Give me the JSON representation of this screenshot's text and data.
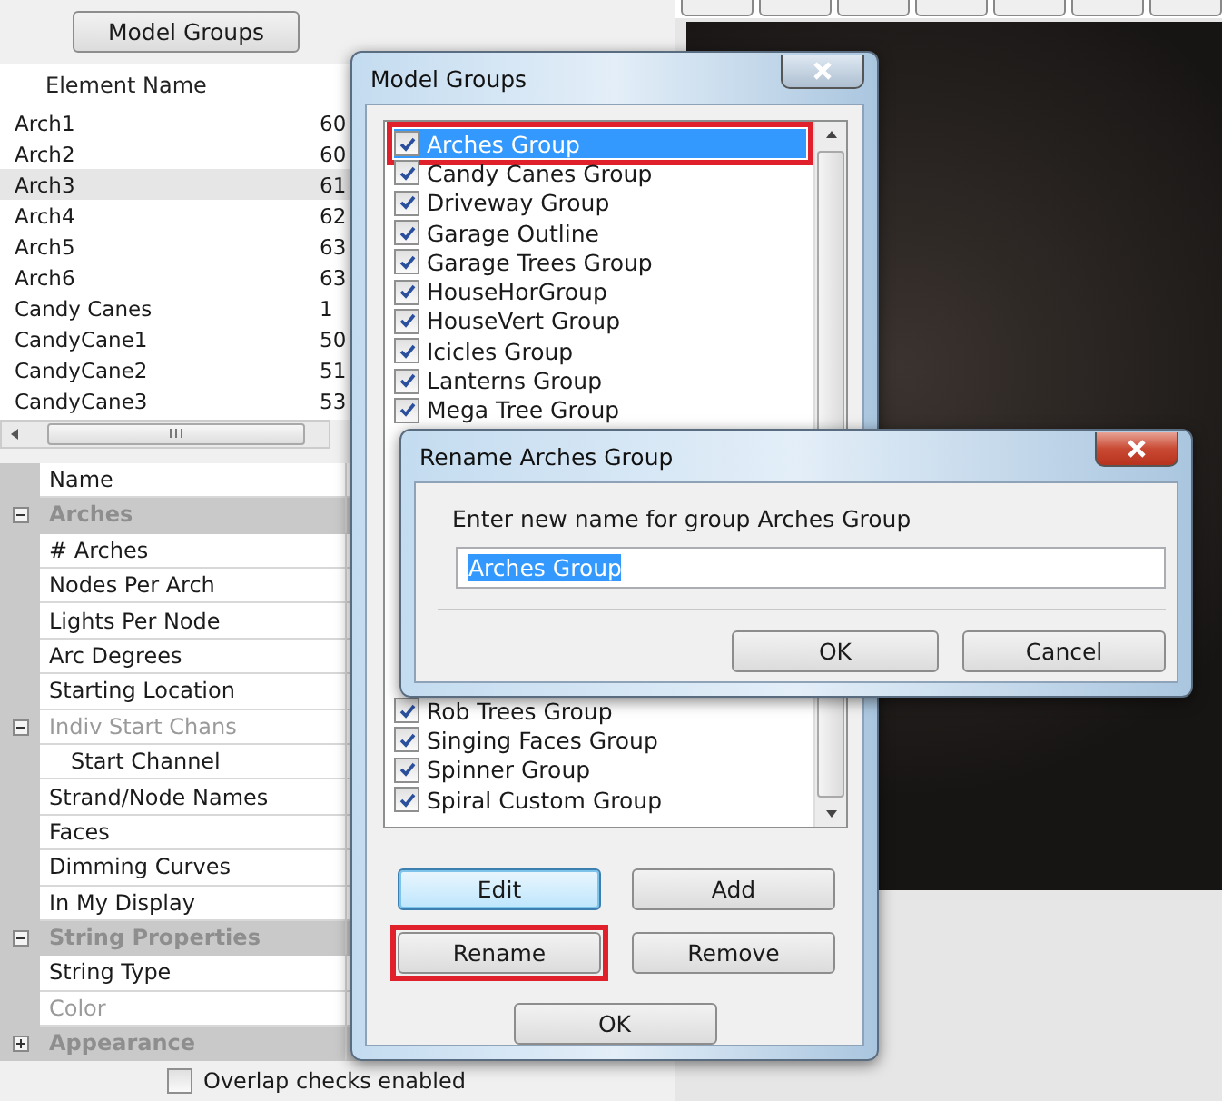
{
  "left_panel": {
    "model_groups_button": "Model Groups",
    "element_list": {
      "columns": [
        "Element Name"
      ],
      "rows": [
        {
          "name": "Arch1",
          "column_2": "60",
          "selected": false
        },
        {
          "name": "Arch2",
          "column_2": "60",
          "selected": false
        },
        {
          "name": "Arch3",
          "column_2": "61",
          "selected": true
        },
        {
          "name": "Arch4",
          "column_2": "62",
          "selected": false
        },
        {
          "name": "Arch5",
          "column_2": "63",
          "selected": false
        },
        {
          "name": "Arch6",
          "column_2": "63",
          "selected": false
        },
        {
          "name": "Candy Canes",
          "column_2": "1",
          "selected": false
        },
        {
          "name": "CandyCane1",
          "column_2": "50",
          "selected": false
        },
        {
          "name": "CandyCane2",
          "column_2": "51",
          "selected": false
        },
        {
          "name": "CandyCane3",
          "column_2": "53",
          "selected": false
        }
      ]
    },
    "properties": [
      {
        "kind": "property",
        "label": "Name",
        "disabled": false
      },
      {
        "kind": "category",
        "label": "Arches",
        "expanded": true,
        "children": [
          {
            "kind": "property",
            "label": "# Arches",
            "disabled": false
          },
          {
            "kind": "property",
            "label": "Nodes Per Arch",
            "disabled": false
          },
          {
            "kind": "property",
            "label": "Lights Per Node",
            "disabled": false
          },
          {
            "kind": "property",
            "label": "Arc Degrees",
            "disabled": false
          },
          {
            "kind": "property",
            "label": "Starting Location",
            "disabled": false
          },
          {
            "kind": "property",
            "label": "Indiv Start Chans",
            "disabled": true,
            "expanded": true,
            "children": [
              {
                "kind": "property",
                "label": "Start Channel",
                "disabled": false
              }
            ]
          },
          {
            "kind": "property",
            "label": "Strand/Node Names",
            "disabled": false
          },
          {
            "kind": "property",
            "label": "Faces",
            "disabled": false
          },
          {
            "kind": "property",
            "label": "Dimming Curves",
            "disabled": false
          },
          {
            "kind": "property",
            "label": "In My Display",
            "disabled": false
          }
        ]
      },
      {
        "kind": "category",
        "label": "String Properties",
        "expanded": true,
        "children": [
          {
            "kind": "property",
            "label": "String Type",
            "disabled": false
          },
          {
            "kind": "property",
            "label": "Color",
            "disabled": true
          }
        ]
      },
      {
        "kind": "category",
        "label": "Appearance",
        "expanded": false
      }
    ],
    "overlap_checkbox": {
      "label": "Overlap checks enabled",
      "checked": false
    }
  },
  "model_groups_dialog": {
    "title": "Model Groups",
    "list_top": [
      {
        "label": "Arches Group",
        "checked": true,
        "selected": true,
        "annotated": true
      },
      {
        "label": "Candy Canes Group",
        "checked": true,
        "selected": false,
        "annotated": false
      },
      {
        "label": "Driveway Group",
        "checked": true,
        "selected": false,
        "annotated": false
      },
      {
        "label": "Garage Outline",
        "checked": true,
        "selected": false,
        "annotated": false
      },
      {
        "label": "Garage Trees Group",
        "checked": true,
        "selected": false,
        "annotated": false
      },
      {
        "label": "HouseHorGroup",
        "checked": true,
        "selected": false,
        "annotated": false
      },
      {
        "label": "HouseVert Group",
        "checked": true,
        "selected": false,
        "annotated": false
      },
      {
        "label": "Icicles Group",
        "checked": true,
        "selected": false,
        "annotated": false
      },
      {
        "label": "Lanterns Group",
        "checked": true,
        "selected": false,
        "annotated": false
      },
      {
        "label": "Mega Tree Group",
        "checked": true,
        "selected": false,
        "annotated": false
      }
    ],
    "list_bottom": [
      {
        "label": "Rob Trees Group",
        "checked": true,
        "selected": false,
        "annotated": false
      },
      {
        "label": "Singing Faces Group",
        "checked": true,
        "selected": false,
        "annotated": false
      },
      {
        "label": "Spinner Group",
        "checked": true,
        "selected": false,
        "annotated": false
      },
      {
        "label": "Spiral Custom Group",
        "checked": true,
        "selected": false,
        "annotated": false
      }
    ],
    "buttons": [
      {
        "label": "Edit",
        "focused": true,
        "annotated": false
      },
      {
        "label": "Add",
        "focused": false,
        "annotated": false
      },
      {
        "label": "Rename",
        "focused": false,
        "annotated": true
      },
      {
        "label": "Remove",
        "focused": false,
        "annotated": false
      }
    ],
    "ok_button": "OK"
  },
  "rename_dialog": {
    "title": "Rename Arches Group",
    "prompt": "Enter new name for group Arches Group",
    "value": "Arches Group",
    "ok_button": "OK",
    "cancel_button": "Cancel"
  }
}
